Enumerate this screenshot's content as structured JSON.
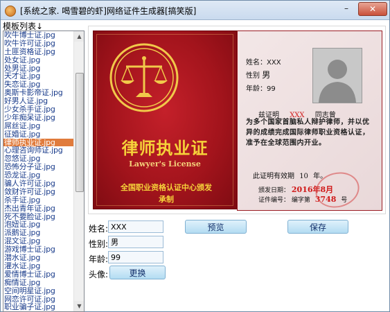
{
  "window": {
    "title": "[系统之家. 喝雪碧的虾]网络证件生成器[搞笑版]",
    "minimize_symbol": "–",
    "close_symbol": "✕"
  },
  "template_list": {
    "label": "模板列表↓",
    "items": [
      "吹牛博士证.jpg",
      "吹牛许可证.jpg",
      "土匪资格证.jpg",
      "处女证.jpg",
      "处男证.jpg",
      "天才证.jpg",
      "失恋证.jpg",
      "奥斯卡影帝证.jpg",
      "好男人证.jpg",
      "少女杀手证.jpg",
      "少年痴呆证.jpg",
      "屌丝证.jpg",
      "征婚证.jpg",
      "律师执业证.jpg",
      "心理咨询师证.jpg",
      "忽悠证.jpg",
      "恐怖分子证.jpg",
      "恐龙证.jpg",
      "骗人许可证.jpg",
      "敛财许可证.jpg",
      "杀手证.jpg",
      "杰出青年证.jpg",
      "死不要脸证.jpg",
      "泡妞证.jpg",
      "派鹅证.jpg",
      "混文证.jpg",
      "游戏博士证.jpg",
      "潜水证.jpg",
      "灌水证.jpg",
      "爱情博士证.jpg",
      "痴情证.jpg",
      "空间明星证.jpg",
      "网恋许可证.jpg",
      "职业骗子证.jpg"
    ],
    "selected_index": 13
  },
  "certificate": {
    "title": "律师执业证",
    "subtitle": "Lawyer's License",
    "org_line1": "全国职业资格认证中心颁发",
    "org_line2": "承制",
    "name_label": "姓名：",
    "name_value": "XXX",
    "gender_label": "性别",
    "gender_value": "男",
    "age_label": "年龄：",
    "age_value": "99",
    "cert_line_prefix": "兹证明",
    "cert_line_name": "XXX",
    "cert_line_suffix": "同志曾",
    "body": "为多个国家首脑私人辩护律师，并以优异的成绩完成国际律师职业资格认证，准予在全球范围内开业。",
    "validity_prefix": "此证明有效期",
    "validity_years": "10",
    "validity_unit": "年。",
    "issue_label": "颁发日期：",
    "issue_date": "2016年8月",
    "number_label": "证件编号：",
    "number_prefix": "编字第",
    "number_value": "3748",
    "number_suffix": "号"
  },
  "form": {
    "name_label": "姓名:",
    "name_value": "XXX",
    "gender_label": "性别:",
    "gender_value": "男",
    "age_label": "年龄:",
    "age_value": "99",
    "avatar_label": "头像:",
    "change_button": "更换",
    "preview_button": "预览",
    "save_button": "保存"
  },
  "colors": {
    "cert_red": "#a3141c",
    "cert_gold": "#f6d23a",
    "list_text": "#1a3c8b",
    "selected_bg": "#e07b3c"
  }
}
